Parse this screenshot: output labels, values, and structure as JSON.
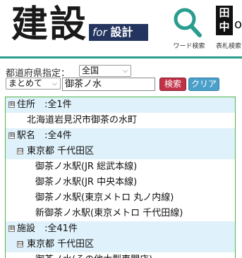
{
  "header": {
    "logo_main": "建設",
    "logo_badge_for": "for",
    "logo_badge_sekkei": "設計",
    "search_link_label": "ワード検索",
    "kanji_box_top": "田",
    "kanji_box_bottom": "中",
    "kanji_o": "o",
    "kanji_link_label": "表札検索",
    "accent_color": "#2a9d8f"
  },
  "form": {
    "pref_label": "都道府県指定：",
    "pref_selected": "全国",
    "mode_selected": "まとめて",
    "query_value": "御茶ノ水",
    "search_button": "検索",
    "clear_button": "クリア"
  },
  "results": {
    "rows": [
      {
        "kind": "cat",
        "toggle": "⊞",
        "text": "住所　:全1件"
      },
      {
        "kind": "item",
        "text": "北海道岩見沢市御茶の水町"
      },
      {
        "kind": "cat",
        "toggle": "⊞",
        "text": "駅名　:全4件"
      },
      {
        "kind": "pref",
        "toggle": "⊟",
        "text": "東京都 千代田区"
      },
      {
        "kind": "item2",
        "text": "御茶ノ水駅(JR 総武本線)"
      },
      {
        "kind": "item2",
        "text": "御茶ノ水駅(JR 中央本線)"
      },
      {
        "kind": "item2",
        "text": "御茶ノ水駅(東京メトロ 丸ノ内線)"
      },
      {
        "kind": "item2",
        "text": "新御茶ノ水駅(東京メトロ 千代田線)"
      },
      {
        "kind": "cat",
        "toggle": "⊞",
        "text": "施設　:全41件"
      },
      {
        "kind": "pref",
        "toggle": "⊟",
        "text": "東京都 千代田区"
      },
      {
        "kind": "item2",
        "text": "御茶ノ水(その他大型専門店)"
      }
    ]
  }
}
